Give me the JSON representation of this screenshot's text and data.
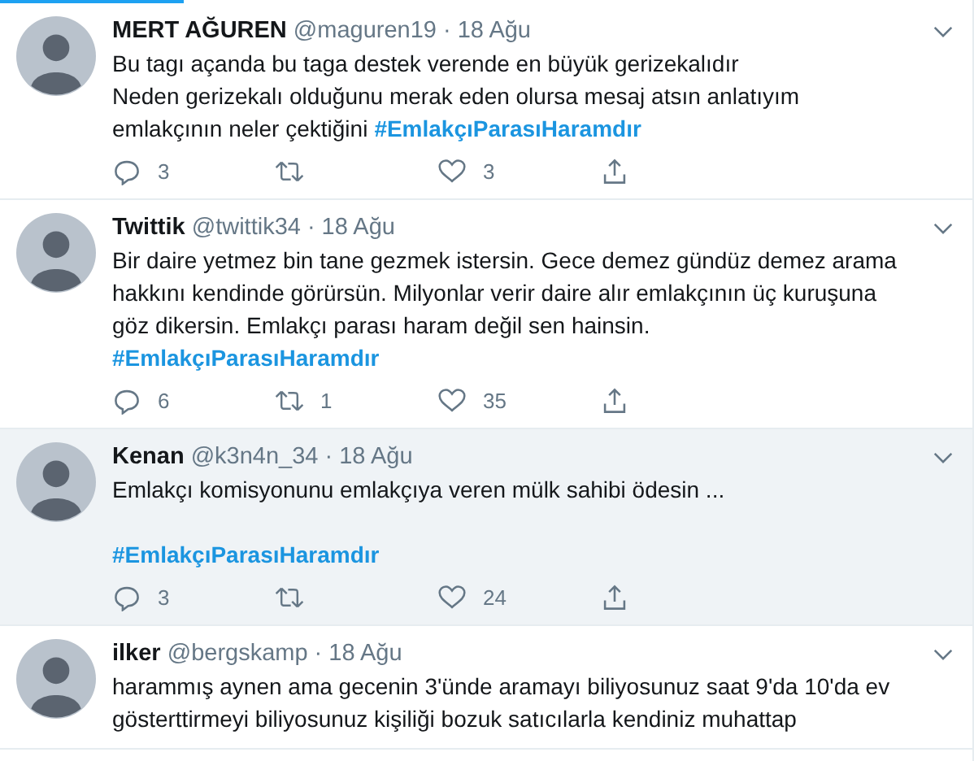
{
  "tweets": [
    {
      "name": "MERT AĞUREN",
      "handle": "@maguren19",
      "date": "· 18 Ağu",
      "highlighted": false,
      "lines": [
        {
          "text": "Bu tagı açanda bu taga destek verende en büyük gerizekalıdır"
        },
        {
          "text": "Neden gerizekalı olduğunu merak eden olursa mesaj atsın anlatıyım"
        },
        {
          "text": "emlakçının neler çektiğini",
          "hashtag": "#EmlakçıParasıHaramdır"
        }
      ],
      "replies": "3",
      "likes": "3"
    },
    {
      "name": "Twittik",
      "handle": "@twittik34",
      "date": "· 18 Ağu",
      "highlighted": false,
      "lines": [
        {
          "text": "Bir daire yetmez bin tane gezmek istersin. Gece demez gündüz demez arama"
        },
        {
          "text": "hakkını kendinde görürsün. Milyonlar verir daire alır emlakçının üç kuruşuna"
        },
        {
          "text": "göz dikersin. Emlakçı parası haram değil sen hainsin."
        },
        {
          "hashtag": "#EmlakçıParasıHaramdır"
        }
      ],
      "replies": "6",
      "retweets": "1",
      "likes": "35"
    },
    {
      "name": "Kenan",
      "handle": "@k3n4n_34",
      "date": "· 18 Ağu",
      "highlighted": true,
      "lines": [
        {
          "text": "Emlakçı komisyonunu emlakçıya veren mülk sahibi ödesin ..."
        },
        {
          "hashtag": "#EmlakçıParasıHaramdır",
          "blank_before": true
        }
      ],
      "replies": "3",
      "likes": "24"
    },
    {
      "name": "ilker",
      "handle": "@bergskamp",
      "date": "· 18 Ağu",
      "highlighted": false,
      "lines": [
        {
          "text": "harammış aynen ama gecenin 3'ünde aramayı biliyosunuz saat 9'da 10'da ev"
        },
        {
          "text": "gösterttirmeyi biliyosunuz kişiliği bozuk satıcılarla kendiniz muhattap"
        }
      ]
    }
  ]
}
